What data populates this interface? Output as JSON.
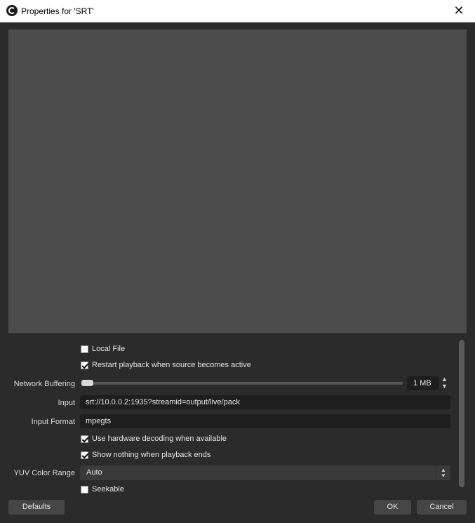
{
  "window": {
    "title": "Properties for 'SRT'",
    "close_glyph": "✕"
  },
  "properties": {
    "local_file": {
      "label": "Local File",
      "checked": false
    },
    "restart_playback": {
      "label": "Restart playback when source becomes active",
      "checked": true
    },
    "network_buffering": {
      "label": "Network Buffering",
      "value": "1 MB",
      "level_fraction": 0.0
    },
    "input": {
      "label": "Input",
      "value": "srt://10.0.0.2:1935?streamid=output/live/pack"
    },
    "input_format": {
      "label": "Input Format",
      "value": "mpegts"
    },
    "hw_decoding": {
      "label": "Use hardware decoding when available",
      "checked": true
    },
    "show_nothing": {
      "label": "Show nothing when playback ends",
      "checked": true
    },
    "yuv_color_range": {
      "label": "YUV Color Range",
      "value": "Auto"
    },
    "seekable": {
      "label": "Seekable",
      "checked": false
    }
  },
  "buttons": {
    "defaults": "Defaults",
    "ok": "OK",
    "cancel": "Cancel"
  },
  "colors": {
    "background": "#2b2b2b",
    "preview": "#4c4c4c",
    "field": "#1e1e1e"
  }
}
